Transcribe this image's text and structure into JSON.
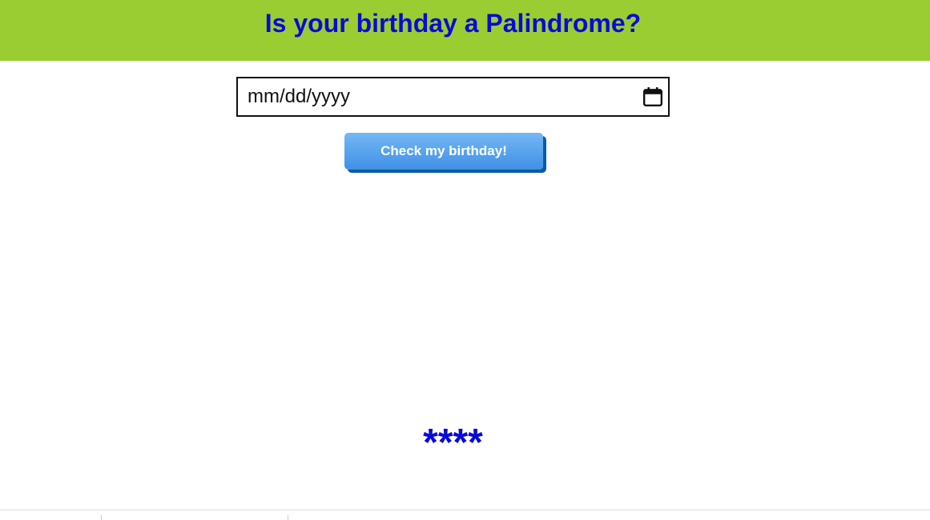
{
  "header": {
    "title": "Is your birthday a Palindrome?",
    "background_color": "#9acd32",
    "title_color": "#0a0ad6"
  },
  "form": {
    "date_placeholder": "mm/dd/yyyy",
    "calendar_icon": "calendar-icon",
    "button_label": "Check my birthday!",
    "button_color": "#3f90e5"
  },
  "result": {
    "text": "****",
    "color": "#0a0ad6"
  }
}
